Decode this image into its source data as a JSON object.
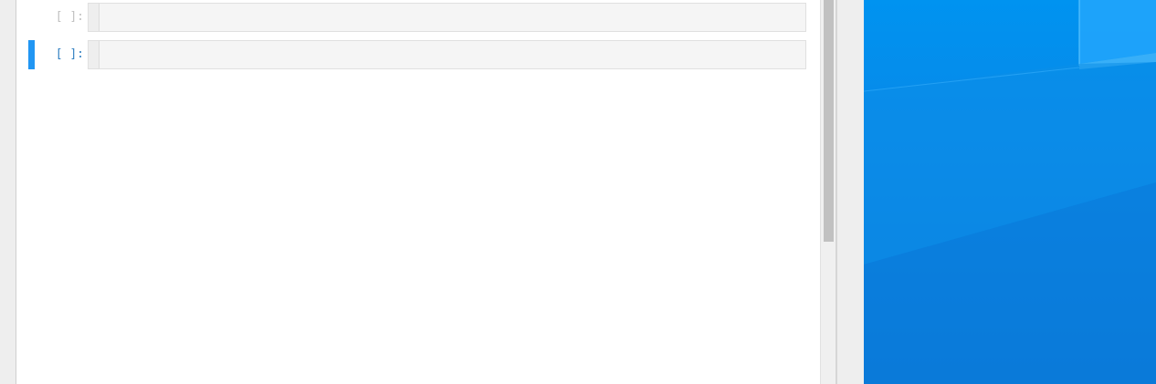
{
  "notebook": {
    "cells": [
      {
        "prompt": "[ ]:",
        "active": false,
        "content": ""
      },
      {
        "prompt": "[ ]:",
        "active": true,
        "content": ""
      }
    ]
  },
  "colors": {
    "active_cell_bar": "#2196f3",
    "active_prompt": "#307fc1",
    "inactive_prompt": "#c0c0c0",
    "desktop_wallpaper": "#0a86e6"
  },
  "icons": {
    "wallpaper": "windows-logo-wallpaper"
  }
}
